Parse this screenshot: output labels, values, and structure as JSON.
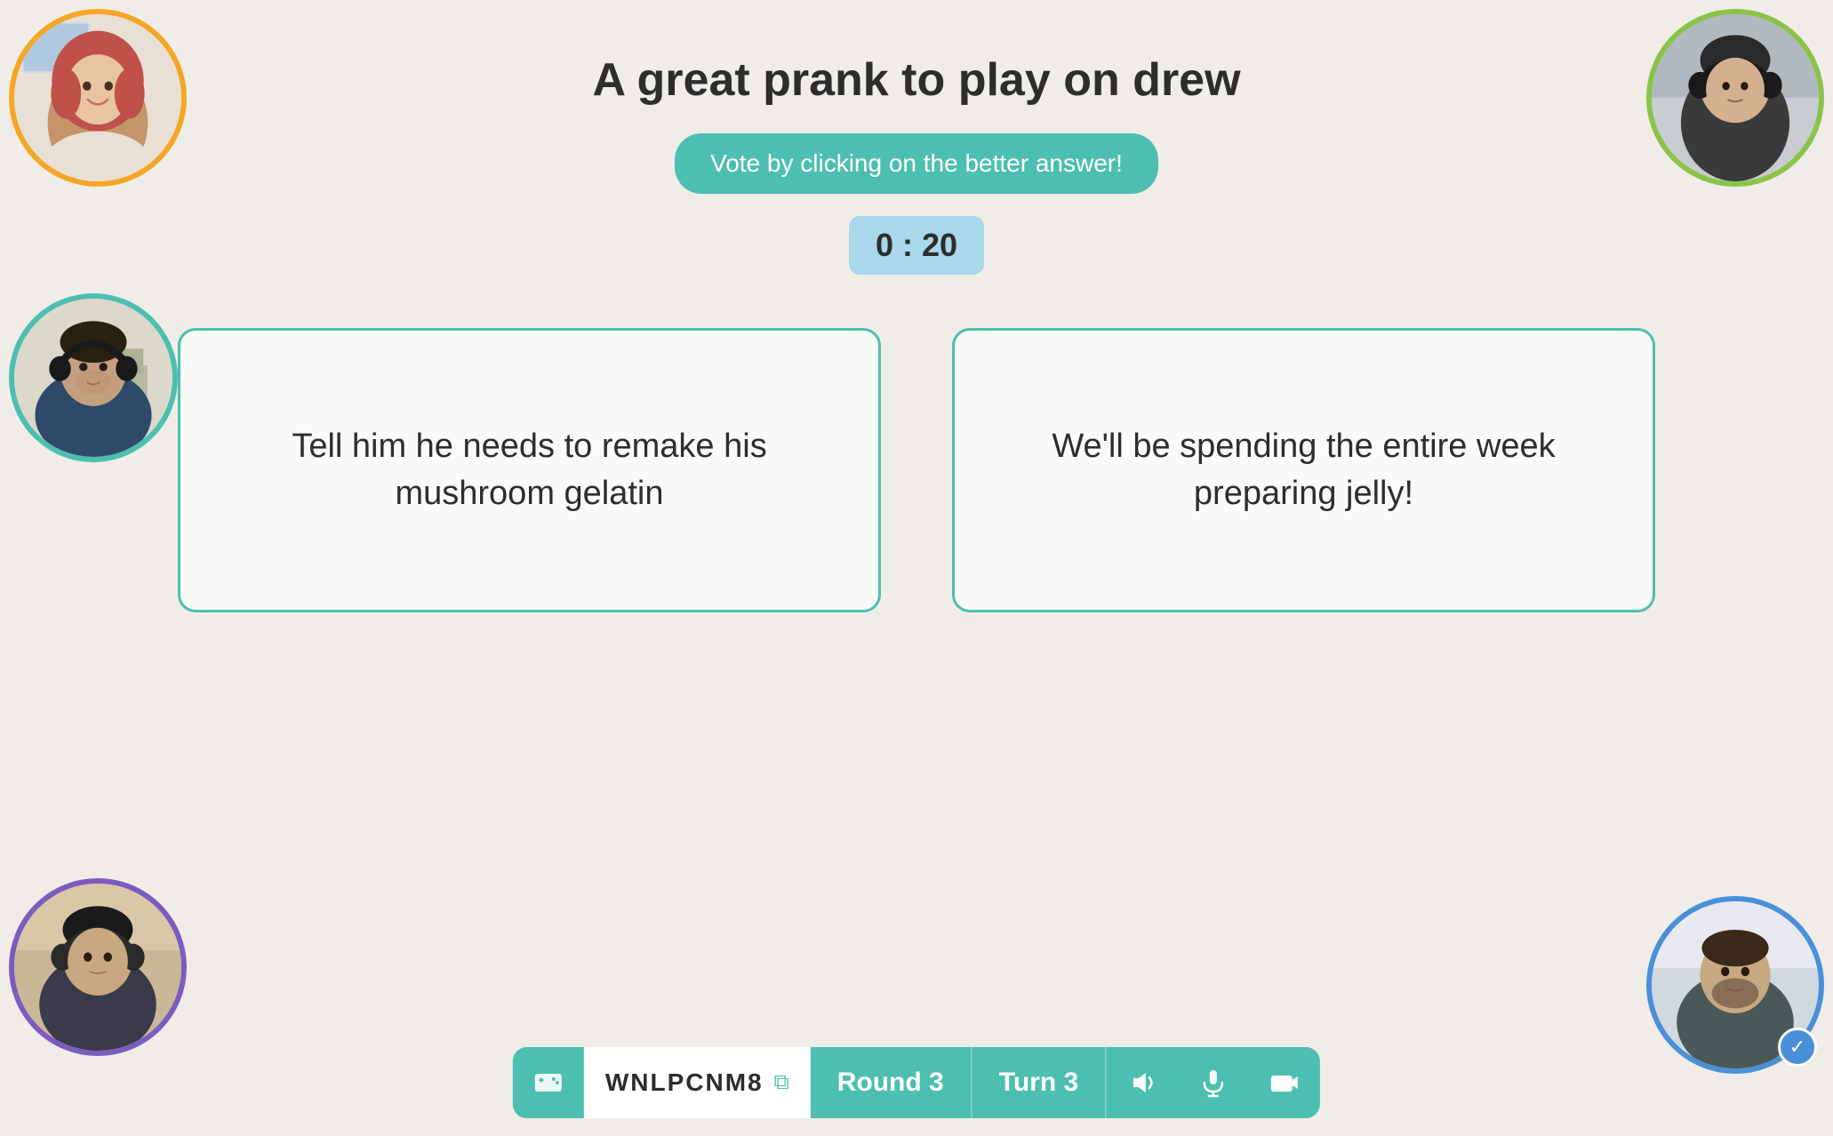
{
  "page": {
    "background_color": "#f0ede8"
  },
  "question": {
    "title": "A great prank to play on drew"
  },
  "vote_button": {
    "label": "Vote by clicking on the better answer!"
  },
  "timer": {
    "display": "0 : 20"
  },
  "answers": [
    {
      "id": "answer-1",
      "text": "Tell him he needs to remake his mushroom gelatin"
    },
    {
      "id": "answer-2",
      "text": "We'll be spending the entire week preparing jelly!"
    }
  ],
  "avatars": [
    {
      "id": "avatar-top-left",
      "position": "top-left",
      "border_color": "#f5a623"
    },
    {
      "id": "avatar-top-right",
      "position": "top-right",
      "border_color": "#8bc34a"
    },
    {
      "id": "avatar-mid-left",
      "position": "mid-left",
      "border_color": "#4dbfb0"
    },
    {
      "id": "avatar-bottom-left",
      "position": "bottom-left",
      "border_color": "#7c5cbf"
    },
    {
      "id": "avatar-bottom-right",
      "position": "bottom-right",
      "border_color": "#4a90d9",
      "has_check": true
    }
  ],
  "toolbar": {
    "game_code": "WNLPCNM8",
    "round_label": "Round 3",
    "turn_label": "Turn 3",
    "icons": {
      "game": "⬛",
      "copy": "⧉",
      "volume": "🔊",
      "mic": "🎤",
      "camera": "📷"
    }
  }
}
